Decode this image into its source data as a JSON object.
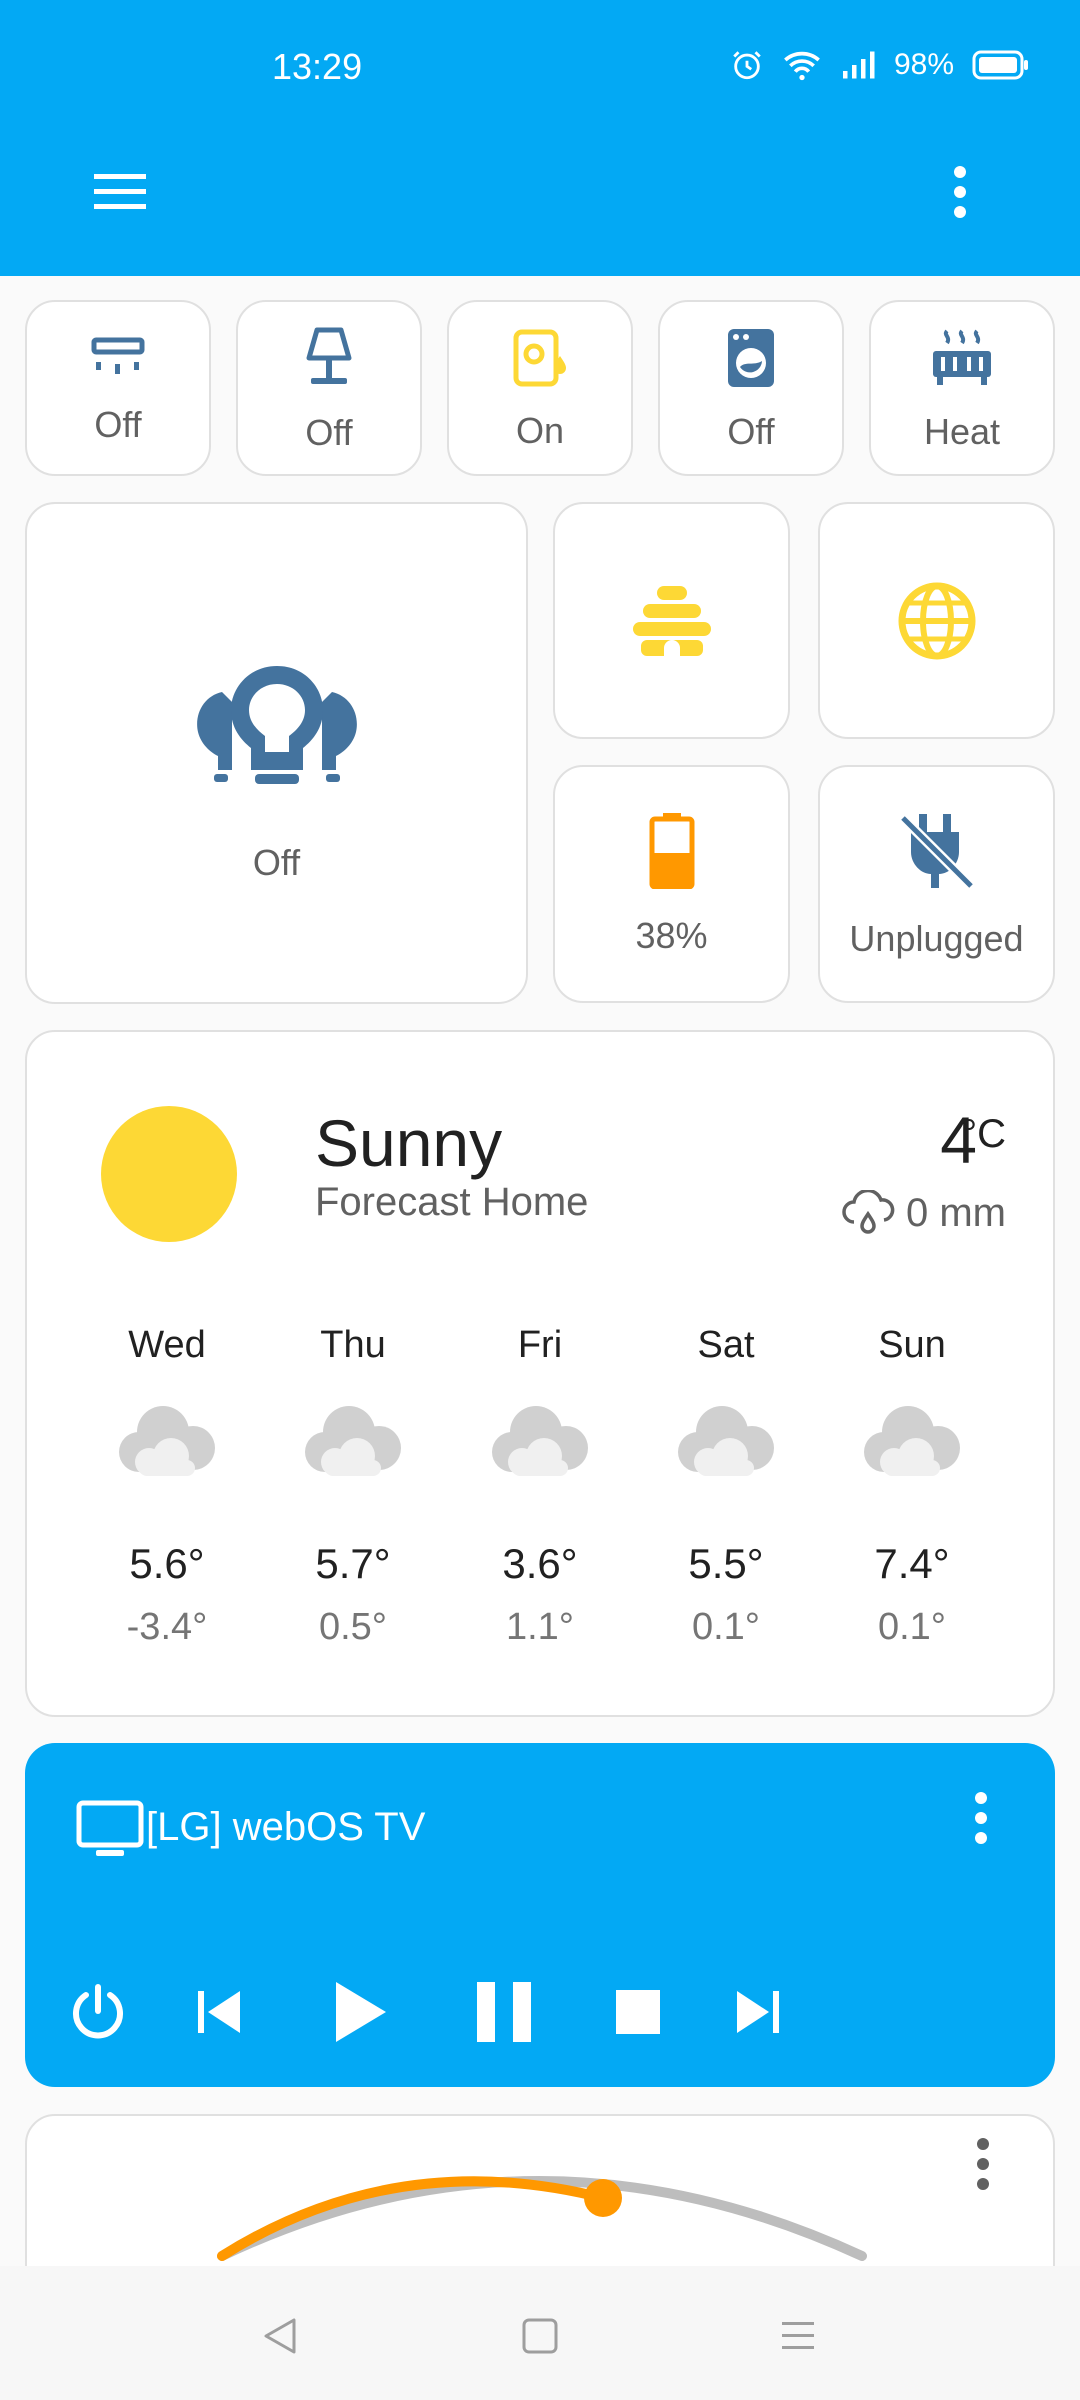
{
  "status_bar": {
    "time": "13:29",
    "battery": "98%",
    "icons": [
      "alarm-icon",
      "wifi-icon",
      "signal-icon",
      "battery-icon"
    ]
  },
  "app_bar": {
    "menu_icon": "hamburger-menu-icon",
    "more_icon": "more-vert-icon"
  },
  "top_tiles": [
    {
      "icon": "air-conditioner-icon",
      "label": "Off",
      "color": "#44739e"
    },
    {
      "icon": "lamp-icon",
      "label": "Off",
      "color": "#44739e"
    },
    {
      "icon": "water-boiler-icon",
      "label": "On",
      "color": "#fdd835"
    },
    {
      "icon": "washing-machine-icon",
      "label": "Off",
      "color": "#44739e"
    },
    {
      "icon": "radiator-icon",
      "label": "Heat",
      "color": "#44739e"
    }
  ],
  "big_tile": {
    "icon": "ceiling-lights-icon",
    "label": "Off",
    "color": "#44739e"
  },
  "grid_tiles": [
    {
      "icon": "beehive-icon",
      "label": "",
      "color": "#fdd835"
    },
    {
      "icon": "globe-icon",
      "label": "",
      "color": "#fdd835"
    },
    {
      "icon": "battery-level-icon",
      "label": "38%",
      "color": "#ff9800"
    },
    {
      "icon": "power-plug-off-icon",
      "label": "Unplugged",
      "color": "#44739e"
    }
  ],
  "weather": {
    "icon": "sunny-icon",
    "condition": "Sunny",
    "name": "Forecast Home",
    "temperature": "4",
    "unit": "°C",
    "precipitation": "0 mm",
    "colors": {
      "sun": "#fdd835",
      "cloud": "#d0d0d0"
    },
    "forecast": [
      {
        "day": "Wed",
        "high": "5.6°",
        "low": "-3.4°",
        "icon": "cloudy-icon"
      },
      {
        "day": "Thu",
        "high": "5.7°",
        "low": "0.5°",
        "icon": "cloudy-icon"
      },
      {
        "day": "Fri",
        "high": "3.6°",
        "low": "1.1°",
        "icon": "cloudy-icon"
      },
      {
        "day": "Sat",
        "high": "5.5°",
        "low": "0.1°",
        "icon": "cloudy-icon"
      },
      {
        "day": "Sun",
        "high": "7.4°",
        "low": "0.1°",
        "icon": "cloudy-icon"
      }
    ]
  },
  "media_player": {
    "title": "[LG] webOS TV",
    "icon": "television-icon",
    "controls": [
      "power-icon",
      "previous-track-icon",
      "play-icon",
      "pause-icon",
      "stop-icon",
      "next-track-icon"
    ],
    "color": "#03a9f4"
  },
  "thermostat": {
    "more_icon": "more-vert-icon",
    "accent": "#ff9800"
  },
  "nav_bar": {
    "icons": [
      "back-icon",
      "home-icon",
      "recents-icon"
    ]
  }
}
